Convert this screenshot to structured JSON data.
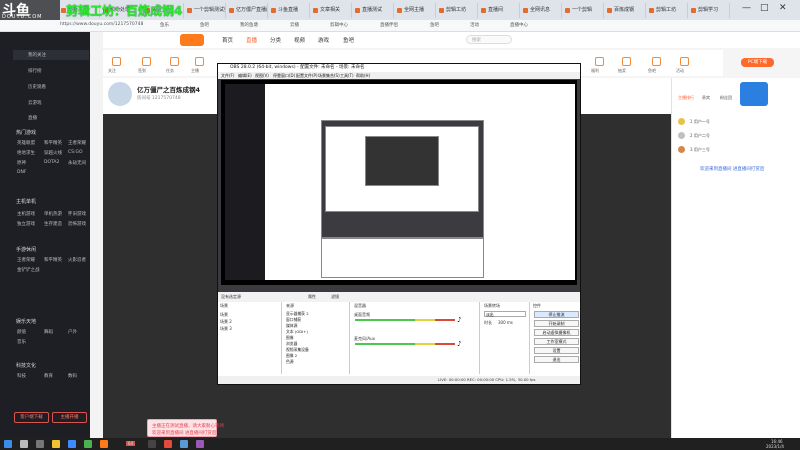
{
  "overlay": {
    "title": "剪辑工坊：百炼成钢4",
    "logo": "斗鱼",
    "logo_sub": "DOUYU.COM"
  },
  "browser": {
    "tabs": [
      "斗鱼",
      "纠纷处理",
      "关注",
      "一个剪辑测试频道",
      "亿万僵尸直播间",
      "斗鱼直播",
      "文章相关",
      "直播测试",
      "全网主播",
      "剪辑工坊",
      "直播间",
      "全网讯息",
      "一个剪辑",
      "百炼成钢",
      "剪辑工坊",
      "剪辑学习",
      "虎牙直播"
    ],
    "address": "https://www.douyu.com/1217570748",
    "bookmarks": [
      "鱼乐",
      "鱼吧",
      "我的鱼塘",
      "云播",
      "剪辑中心",
      "直播伴侣",
      "鱼吧",
      "活动",
      "直播中心"
    ],
    "window_controls": [
      "—",
      "□",
      "✕"
    ]
  },
  "left_panel": {
    "items_top": [
      "我的关注",
      "排行榜",
      "历史观看",
      "云游戏",
      "直播"
    ],
    "section1": "热门游戏",
    "grid1": [
      "英雄联盟",
      "和平精英",
      "王者荣耀",
      "绝地求生",
      "穿越火线",
      "CS:GO",
      "原神",
      "DOTA2",
      "永劫无间",
      "DNF"
    ],
    "section2": "主机单机",
    "grid2": [
      "主机游戏",
      "单机热游",
      "怀旧游戏",
      "独立游戏",
      "生存建造",
      "恐怖游戏"
    ],
    "section3": "手游休闲",
    "grid3": [
      "王者荣耀",
      "和平精英",
      "火影忍者",
      "金铲铲之战"
    ],
    "section4": "娱乐天地",
    "grid4": [
      "颜值",
      "舞蹈",
      "户外",
      "音乐"
    ],
    "section5": "科技文化",
    "grid5": [
      "科技",
      "教育",
      "数码"
    ],
    "buttons": [
      "客户端下载",
      "主播开播"
    ]
  },
  "site": {
    "nav": [
      "首页",
      "直播",
      "分类",
      "视频",
      "游戏",
      "鱼吧"
    ],
    "search_placeholder": "搜索",
    "pc_button": "PC端下载",
    "sub_icons": [
      "关注",
      "签到",
      "任务",
      "主播",
      "福利",
      "抽奖",
      "鱼吧",
      "活动"
    ],
    "streamer_name": "亿万僵尸之百炼成钢4",
    "room": "房间号 1217570748",
    "chat": [
      "主播排行",
      "贵宾",
      "粉丝团",
      "1 用户一号",
      "2 用户二号",
      "3 用户三号"
    ],
    "promo": "欢迎来到直播间 进直播间打赏后",
    "tip": [
      "主播正在测试直播，请大家耐心等待",
      "欢迎来到直播间 进直播间打赏后"
    ]
  },
  "obs": {
    "title": "OBS 28.0.2 (64-bit, windows) - 配置文件: 未命名 - 场景: 未命名",
    "menu": [
      "文件(F)",
      "编辑(E)",
      "视图(V)",
      "停靠窗口(D)",
      "配置文件(P)",
      "场景集合(S)",
      "工具(T)",
      "帮助(H)"
    ],
    "scene_label": "没有选定源",
    "props_btn": "属性",
    "filters_btn": "滤镜",
    "docks": {
      "scenes": {
        "title": "场景",
        "items": [
          "场景",
          "场景 2",
          "场景 3"
        ]
      },
      "sources": {
        "title": "来源",
        "items": [
          "显示器捕获 2",
          "窗口捕获",
          "媒体源",
          "文本 (GDI+)",
          "图像",
          "浏览器",
          "视频采集设备",
          "图像 2",
          "色源"
        ]
      },
      "mixer": {
        "title": "混音器",
        "tracks": [
          "桌面音频",
          "麦克风/Aux"
        ]
      },
      "transitions": {
        "title": "场景转场",
        "type": "淡出",
        "duration_label": "时长",
        "duration": "300 ms"
      },
      "controls": {
        "title": "控件",
        "buttons": [
          "停止推流",
          "开始录制",
          "启动虚拟摄像机",
          "工作室模式",
          "设置",
          "退出"
        ]
      }
    },
    "status": "LIVE: 00:00:00   REC: 00:00:00   CPU: 1.5%, 30.00 fps"
  },
  "taskbar": {
    "time": "16:46",
    "date": "2023/1/4",
    "badge": "64"
  }
}
